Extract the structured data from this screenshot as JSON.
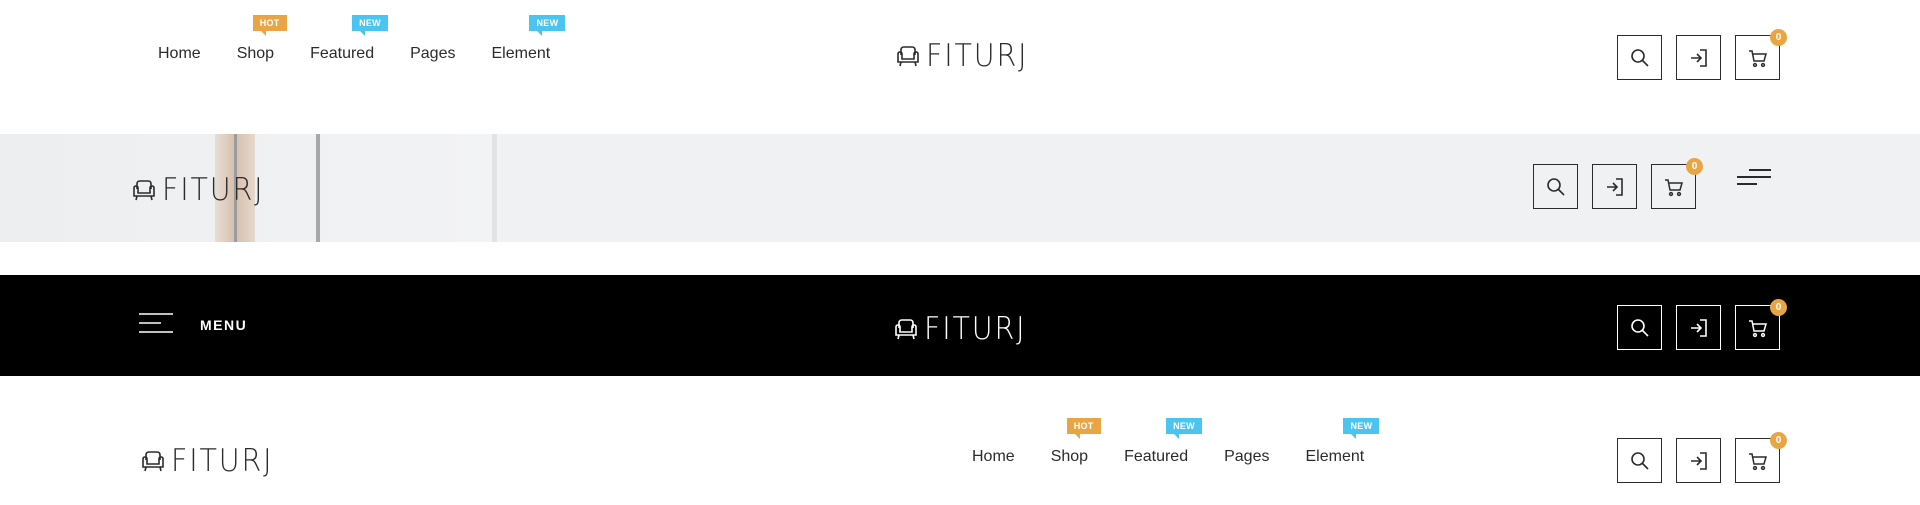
{
  "colors": {
    "badge_hot": "#e9a543",
    "badge_new": "#4bc4ef",
    "cart_count_bg": "#e9a543",
    "dark_header_bg": "#000000",
    "light_header_bg": "#f0f1f3"
  },
  "logo": {
    "text": "FITURJ",
    "icon": "armchair-icon"
  },
  "nav": {
    "items": [
      {
        "label": "Home",
        "badge": ""
      },
      {
        "label": "Shop",
        "badge": "HOT"
      },
      {
        "label": "Featured",
        "badge": "NEW"
      },
      {
        "label": "Pages",
        "badge": ""
      },
      {
        "label": "Element",
        "badge": "NEW"
      }
    ]
  },
  "actions": {
    "search_icon": "search-icon",
    "login_icon": "sign-in-icon",
    "cart_icon": "cart-icon",
    "cart_count": "0"
  },
  "dark_header": {
    "menu_label": "MENU",
    "menu_icon": "hamburger-icon"
  },
  "second_header": {
    "menu_icon": "short-hamburger-icon"
  }
}
